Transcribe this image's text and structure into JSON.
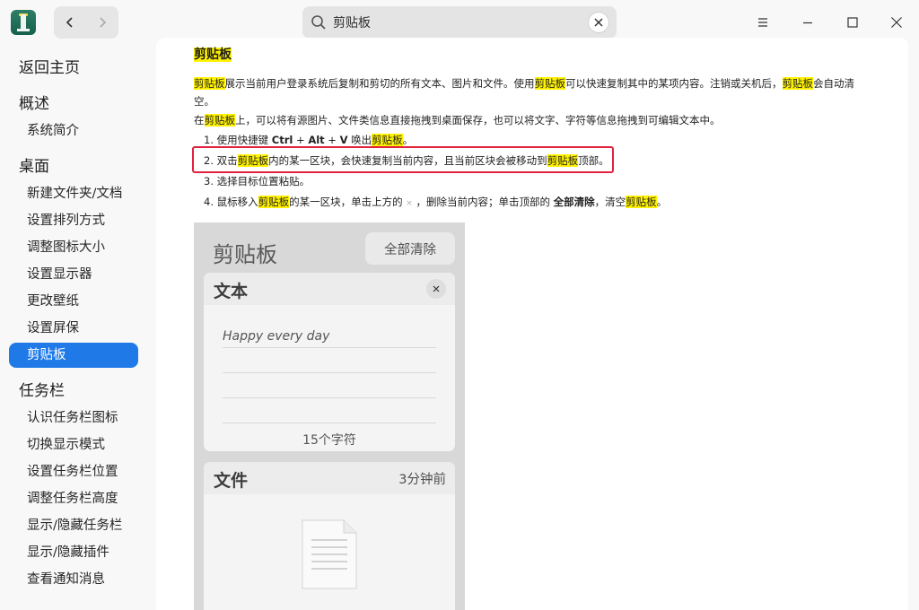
{
  "search": {
    "value": "剪贴板"
  },
  "sidebar": {
    "items": [
      {
        "label": "返回主页"
      },
      {
        "label": "概述"
      },
      {
        "label": "系统简介"
      },
      {
        "label": "桌面"
      },
      {
        "label": "新建文件夹/文档"
      },
      {
        "label": "设置排列方式"
      },
      {
        "label": "调整图标大小"
      },
      {
        "label": "设置显示器"
      },
      {
        "label": "更改壁纸"
      },
      {
        "label": "设置屏保"
      },
      {
        "label": "剪贴板"
      },
      {
        "label": "任务栏"
      },
      {
        "label": "认识任务栏图标"
      },
      {
        "label": "切换显示模式"
      },
      {
        "label": "设置任务栏位置"
      },
      {
        "label": "调整任务栏高度"
      },
      {
        "label": "显示/隐藏任务栏"
      },
      {
        "label": "显示/隐藏插件"
      },
      {
        "label": "查看通知消息"
      }
    ]
  },
  "content": {
    "title": "剪贴板",
    "para1": {
      "kw1": "剪贴板",
      "t1": "展示当前用户登录系统后复制和剪切的所有文本、图片和文件。使用",
      "kw2": "剪贴板",
      "t2": "可以快速复制其中的某项内容。注销或关机后，",
      "kw3": "剪贴板",
      "t3": "会自动清",
      "t4": "空。"
    },
    "para2": {
      "t1": "在",
      "kw1": "剪贴板",
      "t2": "上，可以将有源图片、文件类信息直接拖拽到桌面保存，也可以将文字、字符等信息拖拽到可编辑文本中。"
    },
    "step1": {
      "t1": "1. 使用快捷键 ",
      "b1": "Ctrl",
      "t2": " + ",
      "b2": "Alt",
      "t3": " + ",
      "b3": "V",
      "t4": " 唤出",
      "kw": "剪贴板",
      "t5": "。"
    },
    "step2": {
      "t1": "2. 双击",
      "kw1": "剪贴板",
      "t2": "内的某一区块，会快速复制当前内容，且当前区块会被移动到",
      "kw2": "剪贴板",
      "t3": "顶部。"
    },
    "step3": {
      "t1": "3. 选择目标位置粘贴。"
    },
    "step4": {
      "t1": "4. 鼠标移入",
      "kw1": "剪贴板",
      "t2": "的某一区块，单击上方的",
      "x": "×",
      "t3": "，删除当前内容；单击顶部的 ",
      "b1": "全部清除",
      "t4": "，清空",
      "kw2": "剪贴板",
      "t5": "。"
    }
  },
  "illustration": {
    "title": "剪贴板",
    "clear_all": "全部清除",
    "text_card": {
      "title": "文本",
      "text": "Happy every day",
      "count": "15个字符"
    },
    "file_card": {
      "title": "文件",
      "time": "3分钟前"
    }
  }
}
